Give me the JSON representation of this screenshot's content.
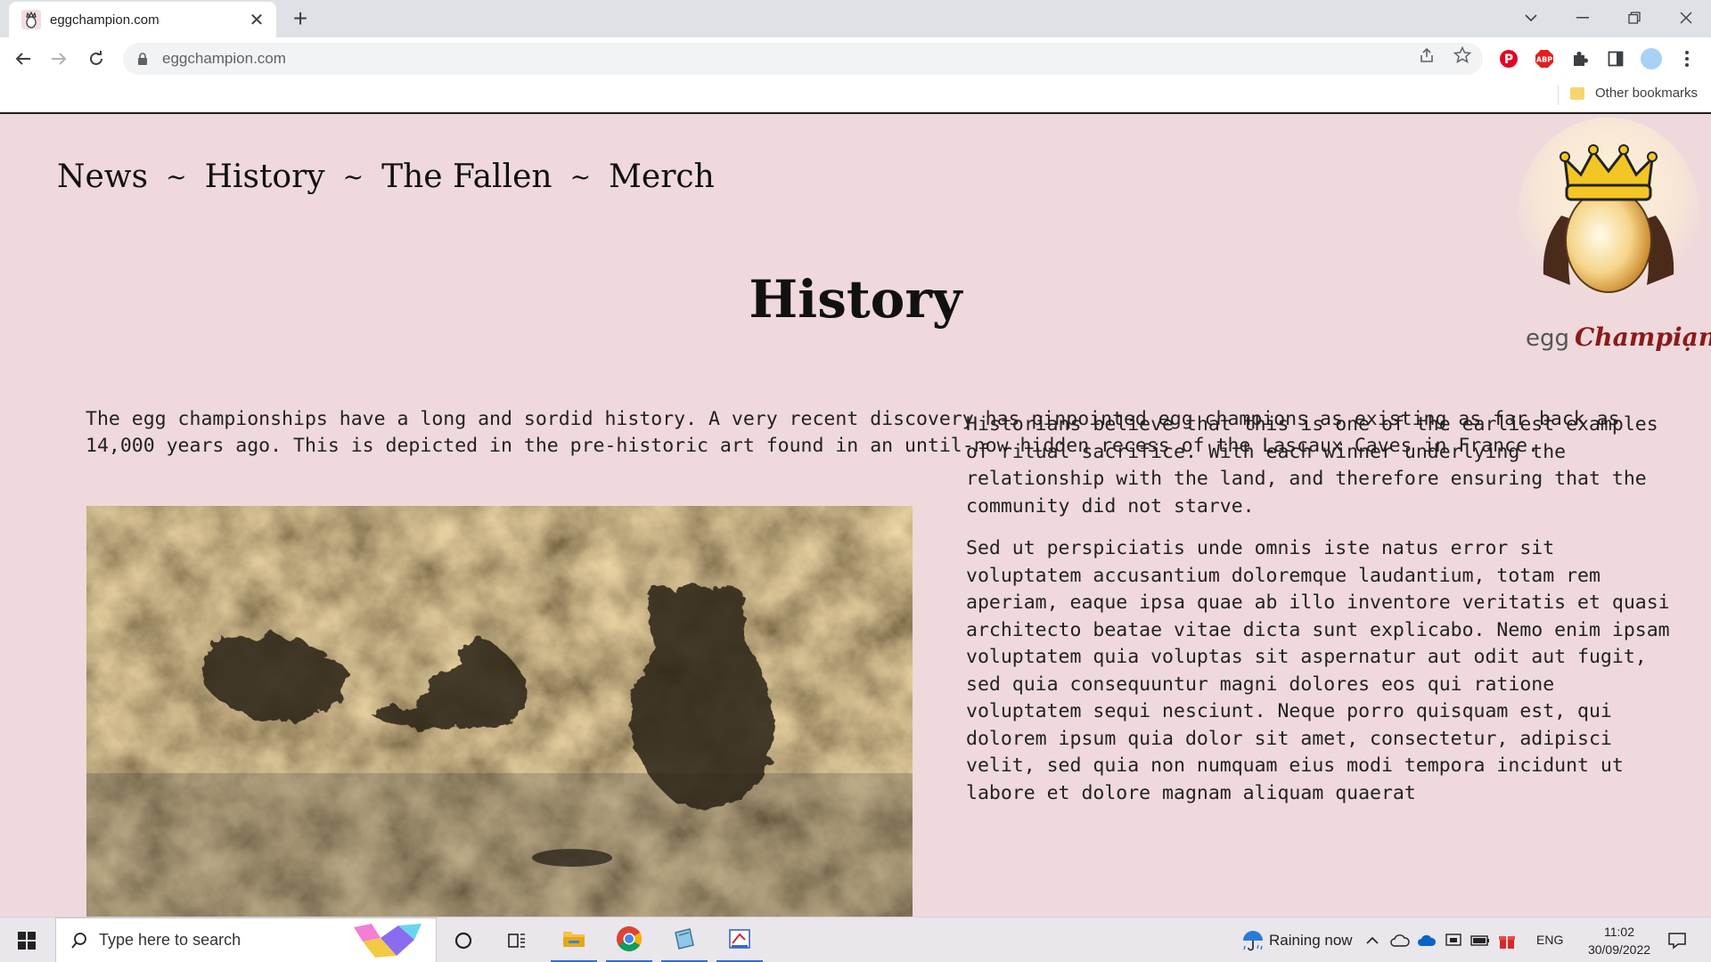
{
  "browser": {
    "tab_title": "eggchampion.com",
    "url": "eggchampion.com",
    "bookmarks_other": "Other bookmarks",
    "extensions": [
      "pinterest-icon",
      "adblock-plus-icon",
      "puzzle-icon",
      "sidepanel-icon",
      "profile-icon",
      "menu-icon"
    ]
  },
  "site": {
    "nav": {
      "news": "News",
      "history": "History",
      "fallen": "The Fallen",
      "merch": "Merch",
      "sep": "~"
    },
    "logo": {
      "egg": "egg",
      "champion": "Champiạn"
    },
    "title": "History",
    "intro": "The egg championships have a long and sordid history. A very recent discovery has pinpointed egg champions as existing as far back as 14,000 years ago. This is depicted in the pre-historic art found in an until-now hidden recess of the Lascaux Caves in France.",
    "para1": "Historians believe that this is one of the earliest examples of ritual sacrifice. With each winner underlying the  relationship with the land, and therefore ensuring that the community did not starve.",
    "para2": "Sed ut perspiciatis unde omnis iste natus error sit voluptatem accusantium doloremque laudantium, totam rem aperiam, eaque ipsa quae ab illo inventore veritatis et quasi architecto beatae vitae dicta sunt explicabo. Nemo enim ipsam voluptatem quia voluptas sit aspernatur aut odit aut fugit, sed quia consequuntur magni dolores eos qui ratione voluptatem sequi nesciunt. Neque porro quisquam est, qui dolorem ipsum quia dolor sit amet, consectetur, adipisci velit, sed quia non numquam eius modi tempora incidunt ut labore et dolore magnam aliquam quaerat"
  },
  "taskbar": {
    "search_placeholder": "Type here to search",
    "weather": "Raining now",
    "lang": "ENG",
    "time": "11:02",
    "date": "30/09/2022"
  }
}
